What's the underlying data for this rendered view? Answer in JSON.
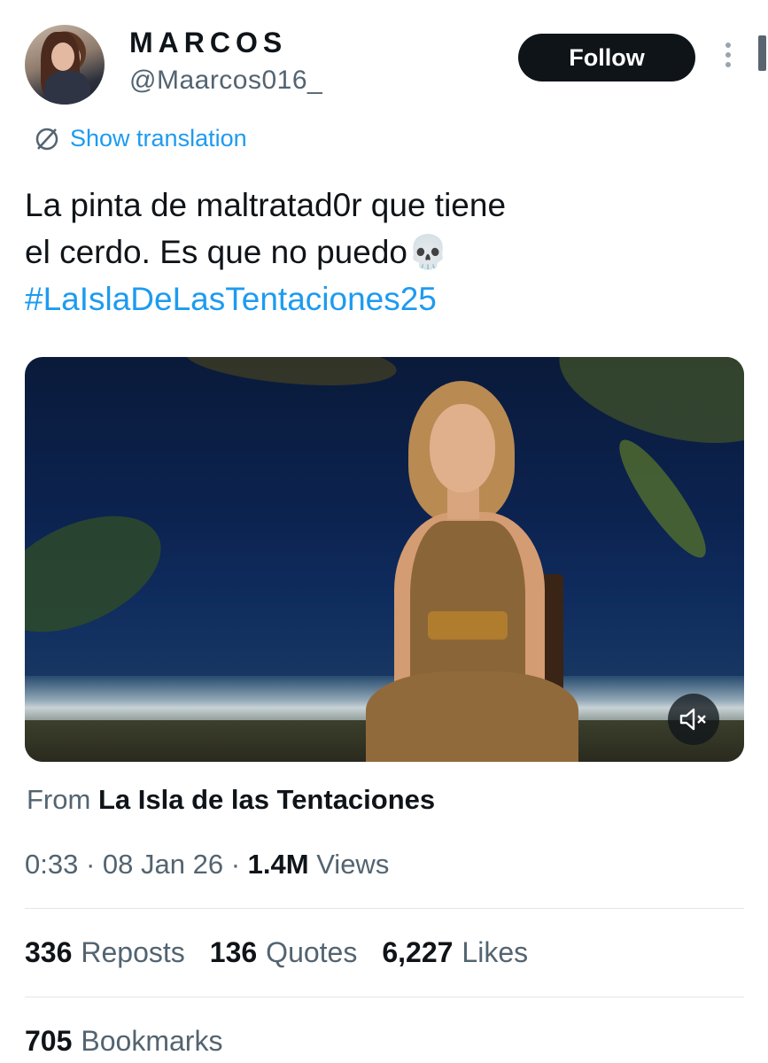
{
  "author": {
    "display_name": "MARCOS",
    "handle": "@Maarcos016_"
  },
  "actions": {
    "follow_label": "Follow"
  },
  "translation": {
    "label": "Show translation"
  },
  "tweet": {
    "text_line1": "La pinta de maltratad0r que tiene",
    "text_line2": "el cerdo. Es que no puedo",
    "emoji": "💀",
    "hashtag": "#LaIslaDeLasTentaciones25"
  },
  "source": {
    "prefix": "From",
    "name": "La Isla de las Tentaciones"
  },
  "meta": {
    "duration": "0:33",
    "date": "08 Jan 26",
    "views_count": "1.4M",
    "views_label": "Views"
  },
  "stats": {
    "reposts_count": "336",
    "reposts_label": "Reposts",
    "quotes_count": "136",
    "quotes_label": "Quotes",
    "likes_count": "6,227",
    "likes_label": "Likes",
    "bookmarks_count": "705",
    "bookmarks_label": "Bookmarks"
  },
  "colors": {
    "accent": "#1d9bf0",
    "text_primary": "#0f1419",
    "text_secondary": "#536471",
    "follow_bg": "#0f1419"
  }
}
